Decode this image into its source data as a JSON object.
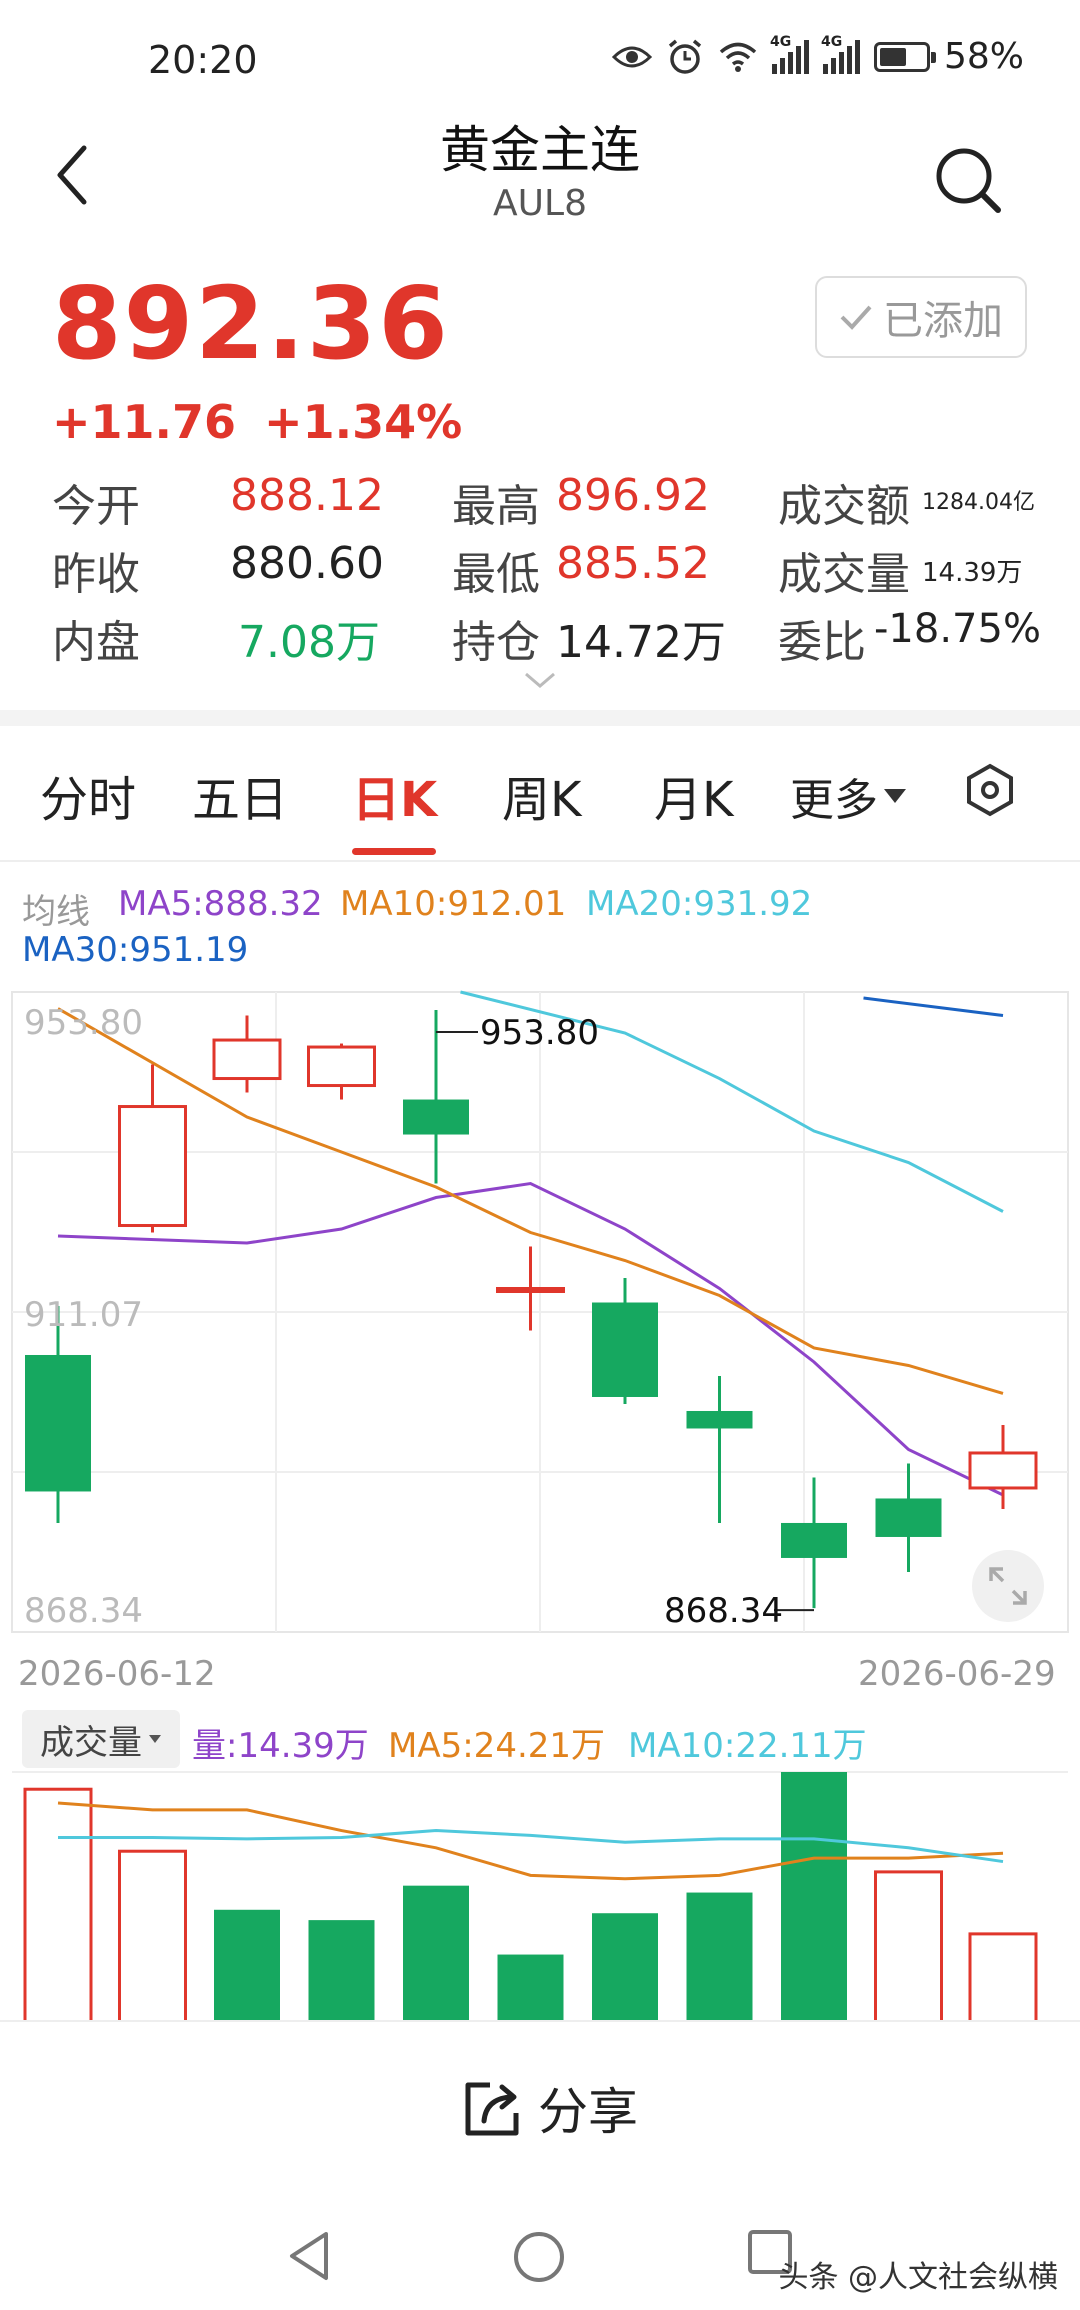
{
  "status_bar": {
    "time": "20:20",
    "battery": "58%",
    "battery_level": 0.58,
    "network_1": "4G",
    "network_2": "4G"
  },
  "header": {
    "title": "黄金主连",
    "subtitle": "AUL8"
  },
  "quote": {
    "price": "892.36",
    "change": "+11.76",
    "change_pct": "+1.34%",
    "added_label": "已添加"
  },
  "stats": {
    "open_label": "今开",
    "open": "888.12",
    "prev_close_label": "昨收",
    "prev_close": "880.60",
    "inner_label": "内盘",
    "inner": "7.08万",
    "high_label": "最高",
    "high": "896.92",
    "low_label": "最低",
    "low": "885.52",
    "oi_label": "持仓",
    "oi": "14.72万",
    "amount_label": "成交额",
    "amount": "1284.04亿",
    "volume_label": "成交量",
    "volume": "14.39万",
    "ratio_label": "委比",
    "ratio": "-18.75%"
  },
  "tabs": [
    "分时",
    "五日",
    "日K",
    "周K",
    "月K",
    "更多"
  ],
  "ma_legend": {
    "label": "均线",
    "ma5": "MA5:888.32",
    "ma10": "MA10:912.01",
    "ma20": "MA20:931.92",
    "ma30": "MA30:951.19"
  },
  "colors": {
    "up": "#e0362b",
    "down": "#16a860",
    "ma5": "#8e44c9",
    "ma10": "#e0821d",
    "ma20": "#4fc8dc",
    "ma30": "#1a62c2"
  },
  "chart_data": {
    "type": "candlestick",
    "y_ticks": [
      "953.80",
      "911.07",
      "868.34"
    ],
    "ylim": [
      868.34,
      953.8
    ],
    "max_label": "953.80",
    "min_label": "868.34",
    "date_start": "2026-06-12",
    "date_end": "2026-06-29",
    "candles": [
      {
        "open": 904.5,
        "close": 885.0,
        "high": 911.5,
        "low": 880.5
      },
      {
        "open": 923.0,
        "close": 940.0,
        "high": 946.0,
        "low": 922.0
      },
      {
        "open": 944.0,
        "close": 949.5,
        "high": 953.0,
        "low": 942.0
      },
      {
        "open": 943.0,
        "close": 948.5,
        "high": 949.0,
        "low": 941.0
      },
      {
        "open": 941.0,
        "close": 936.0,
        "high": 953.8,
        "low": 929.0
      },
      {
        "open": 914.0,
        "close": 914.0,
        "high": 920.0,
        "low": 908.0
      },
      {
        "open": 912.0,
        "close": 898.5,
        "high": 915.5,
        "low": 897.5
      },
      {
        "open": 896.5,
        "close": 894.0,
        "high": 901.5,
        "low": 880.5
      },
      {
        "open": 880.5,
        "close": 875.5,
        "high": 887.0,
        "low": 868.34
      },
      {
        "open": 884.0,
        "close": 878.5,
        "high": 889.0,
        "low": 873.5
      },
      {
        "open": 885.5,
        "close": 890.5,
        "high": 894.5,
        "low": 882.5
      }
    ],
    "ma5": [
      921.5,
      null,
      920.5,
      922.5,
      927.0,
      929.0,
      922.5,
      914.0,
      903.5,
      891.0,
      884.5
    ],
    "ma10": [
      954.0,
      null,
      938.5,
      933.5,
      928.5,
      922.0,
      918.0,
      913.0,
      905.5,
      903.0,
      899.0
    ],
    "ma20": [
      null,
      null,
      null,
      null,
      null,
      956.0,
      950.5,
      944.0,
      936.5,
      932.0,
      925.0
    ],
    "ma30": [
      null,
      null,
      null,
      null,
      null,
      null,
      null,
      null,
      null,
      null,
      953.0
    ]
  },
  "volume": {
    "label": "成交量",
    "vol": "量:14.39万",
    "ma5": "MA5:24.21万",
    "ma10": "MA10:22.11万",
    "bars": [
      33.5,
      24.5,
      16.0,
      14.5,
      19.5,
      9.5,
      15.5,
      18.5,
      36.0,
      21.5,
      12.5
    ],
    "up": [
      true,
      true,
      false,
      false,
      false,
      false,
      false,
      false,
      false,
      true,
      true
    ],
    "ma5_line": [
      31.5,
      30.5,
      30.5,
      27.5,
      25.0,
      21.0,
      20.5,
      21.0,
      23.5,
      23.5,
      24.2
    ],
    "ma10_line": [
      26.5,
      26.5,
      26.3,
      26.5,
      27.5,
      26.8,
      25.8,
      26.3,
      26.3,
      25.0,
      23.0
    ],
    "ymax": 36.0
  },
  "bottom": {
    "share_label": "分享"
  },
  "watermark": "头条 @人文社会纵横"
}
